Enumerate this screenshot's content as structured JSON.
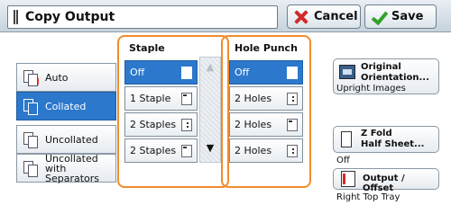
{
  "header": {
    "title": "Copy Output",
    "cancel_label": "Cancel",
    "save_label": "Save"
  },
  "left_options": [
    {
      "label": "Auto",
      "icon": "auto-pages-icon",
      "selected": false
    },
    {
      "label": "Collated",
      "icon": "collated-pages-icon",
      "selected": true
    },
    {
      "label": "Uncollated",
      "icon": "uncollated-pages-icon",
      "selected": false
    },
    {
      "label": "Uncollated with Separators",
      "label_line1": "Uncollated with",
      "label_line2": "Separators",
      "icon": "separators-pages-icon",
      "selected": false
    }
  ],
  "staple": {
    "title": "Staple",
    "options": [
      "Off",
      "1 Staple",
      "2 Staples",
      "2 Staples"
    ],
    "selected_index": 0
  },
  "hole_punch": {
    "title": "Hole Punch",
    "options": [
      "Off",
      "2 Holes",
      "2 Holes",
      "2 Holes"
    ],
    "selected_index": 0
  },
  "right": {
    "orientation": {
      "line1": "Original",
      "line2": "Orientation...",
      "value": "Upright Images"
    },
    "zfold": {
      "line1": "Z Fold",
      "line2": "Half Sheet...",
      "value": "Off"
    },
    "output": {
      "label": "Output / Offset",
      "value": "Right Top Tray"
    }
  },
  "colors": {
    "selected": "#2c78cc",
    "highlight_outline": "#f28b2a",
    "cancel_icon": "#d12a2a",
    "save_icon": "#33a12a"
  }
}
